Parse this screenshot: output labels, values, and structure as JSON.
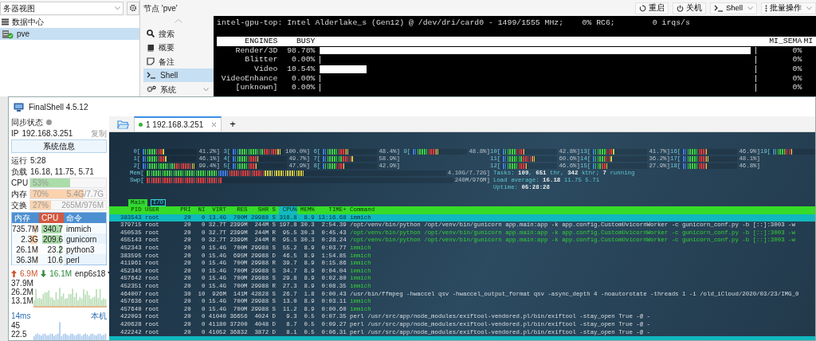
{
  "proxmox": {
    "tree": {
      "view_select": "务器视图",
      "items": [
        {
          "label": "数据中心",
          "kind": "datacenter",
          "selected": false
        },
        {
          "label": "pve",
          "kind": "node",
          "selected": true
        }
      ]
    },
    "header": {
      "title": "节点 'pve'",
      "buttons": [
        {
          "label": "重启",
          "kind": "restart",
          "dropdown": false
        },
        {
          "label": "关机",
          "kind": "power",
          "dropdown": false
        },
        {
          "label": "Shell",
          "kind": "shell",
          "dropdown": true
        },
        {
          "label": "批量操作",
          "kind": "bulk",
          "dropdown": true
        }
      ]
    },
    "nav": [
      {
        "label": "搜索",
        "kind": "search",
        "selected": false,
        "expandable": false
      },
      {
        "label": "概要",
        "kind": "summary",
        "selected": false,
        "expandable": false
      },
      {
        "label": "备注",
        "kind": "notes",
        "selected": false,
        "expandable": false
      },
      {
        "label": "Shell",
        "kind": "shell",
        "selected": true,
        "expandable": false
      },
      {
        "label": "系统",
        "kind": "system",
        "selected": false,
        "expandable": true
      }
    ],
    "gpu_top": {
      "title_line": "intel-gpu-top: Intel Alderlake_s (Gen12) @ /dev/dri/card0 - 1499/1555 MHz;    0% RC6;        0 irqs/s",
      "columns": [
        "ENGINES",
        "BUSY",
        "MI_SEMA",
        "MI"
      ],
      "rows": [
        {
          "engine": "Render/3D",
          "busy": "98.78%",
          "level": 0.9878,
          "sema": "0%"
        },
        {
          "engine": "Blitter",
          "busy": "0.00%",
          "level": 0,
          "sema": "0%"
        },
        {
          "engine": "Video",
          "busy": "10.54%",
          "level": 0.1054,
          "sema": "0%"
        },
        {
          "engine": "VideoEnhance",
          "busy": "0.00%",
          "level": 0,
          "sema": "0%"
        },
        {
          "engine": "[unknown]",
          "busy": "0.00%",
          "level": 0,
          "sema": "0%"
        }
      ]
    }
  },
  "finalshell": {
    "title": "FinalShell 4.5.12",
    "sidebar": {
      "sync_label": "同步状态",
      "sync_on": false,
      "ip_label": "IP",
      "ip": "192.168.3.251",
      "copy": "复制",
      "sysinfo_button": "系统信息",
      "uptime_label": "运行",
      "uptime": "5:28",
      "load_label": "负载",
      "load": "16.18, 11.75, 5.71",
      "meters": [
        {
          "label": "CPU",
          "percent": "53%",
          "level": 0.53,
          "kind": "cpu"
        },
        {
          "label": "内存",
          "percent": "70%",
          "detail": "5.4G/7.7G",
          "level": 0.7,
          "kind": "memory"
        },
        {
          "label": "交换",
          "percent": "27%",
          "detail": "265M/976M",
          "level": 0.27,
          "kind": "swap"
        }
      ],
      "process_columns": [
        {
          "label": "内存",
          "sorted": false
        },
        {
          "label": "CPU",
          "sorted": true
        },
        {
          "label": "命令",
          "sorted": false
        }
      ],
      "processes": [
        {
          "mem": {
            "text": "735.7M",
            "level": 0.1
          },
          "cpu": {
            "text": "340.7",
            "level": 1
          },
          "command": "immich"
        },
        {
          "mem": {
            "text": "2.3G",
            "level": 0.3
          },
          "cpu": {
            "text": "209.6",
            "level": 0.95
          },
          "command": "gunicorn"
        },
        {
          "mem": {
            "text": "26.1M",
            "level": 0.03
          },
          "cpu": {
            "text": "23.2",
            "level": 0.12
          },
          "command": "python3"
        },
        {
          "mem": {
            "text": "36.3M",
            "level": 0.03
          },
          "cpu": {
            "text": "10.6",
            "level": 0.06
          },
          "command": "perl"
        }
      ],
      "network": {
        "upload": "6.9M",
        "download": "16.1M",
        "interface": "enp6s18",
        "scale": [
          "37.9M",
          "26.2M",
          "13.1M"
        ]
      },
      "ping": {
        "latency": "14ms",
        "target": "本机",
        "scale": [
          "45",
          "22.5"
        ]
      }
    },
    "tabs": [
      {
        "label": "1 192.168.3.251",
        "selected": true,
        "connected": true
      }
    ],
    "new_tab": "+",
    "htop": {
      "cpu_columns": [
        [
          {
            "label": "0[",
            "reading": "41.2%]",
            "level": 0.412
          },
          {
            "label": "1[",
            "reading": "46.1%]",
            "level": 0.461
          },
          {
            "label": "2[",
            "reading": "99.4%]",
            "level": 0.994
          }
        ],
        [
          {
            "label": "3[",
            "reading": "100.0%]",
            "level": 1
          },
          {
            "label": "4[",
            "reading": "49.7%]",
            "level": 0.497
          },
          {
            "label": "5[",
            "reading": "47.9%]",
            "level": 0.479
          }
        ],
        [
          {
            "label": "6[",
            "reading": "48.4%]",
            "level": 0.484
          },
          {
            "label": "7[",
            "reading": "58.9%]",
            "level": 0.589
          },
          {
            "label": "8[",
            "reading": "42.9%]",
            "level": 0.429
          }
        ],
        [
          {
            "label": "9[",
            "reading": "48.8%]",
            "level": 0.488
          }
        ],
        [
          {
            "label": "10[",
            "reading": "42.8%]",
            "level": 0.428
          },
          {
            "label": "11[",
            "reading": "60.6%]",
            "level": 0.606
          },
          {
            "label": "12[",
            "reading": "46.6%]",
            "level": 0.466
          }
        ],
        [
          {
            "label": "13[",
            "reading": "41.7%]",
            "level": 0.417
          },
          {
            "label": "14[",
            "reading": "36.2%]",
            "level": 0.362
          },
          {
            "label": "15[",
            "reading": "27.9%]",
            "level": 0.279
          }
        ],
        [
          {
            "label": "16[",
            "reading": "46.9%]",
            "level": 0.469
          },
          {
            "label": "17[",
            "reading": "48.1%]",
            "level": 0.481
          },
          {
            "label": "18[",
            "reading": "46.8%]",
            "level": 0.468
          }
        ],
        [
          {
            "label": "19[",
            "level": 0.5
          }
        ]
      ],
      "memory_meters": [
        {
          "label": "Mem[",
          "reading": "4.10G/7.72G]",
          "level": 0.53,
          "kind": "mem"
        },
        {
          "label": "Swp[",
          "reading": "240M/976M]",
          "level": 0.25,
          "kind": "swap"
        }
      ],
      "summary": [
        "Tasks: **109**, **651** thr, **342** kthr; **7** running",
        "Load average: **16.18** 11.75 5.71",
        "Uptime: **05:28:28**"
      ],
      "tabs": [
        {
          "label": "Main",
          "selected": true
        },
        {
          "label": "I/O",
          "selected": false
        }
      ],
      "columns": [
        {
          "label": "PID",
          "sorted": false
        },
        {
          "label": "USER",
          "sorted": false
        },
        {
          "label": "PRI",
          "sorted": false
        },
        {
          "label": "NI",
          "sorted": false
        },
        {
          "label": "VIRT",
          "sorted": false
        },
        {
          "label": "RES",
          "sorted": false
        },
        {
          "label": "SHR",
          "sorted": false
        },
        {
          "label": "S",
          "sorted": false
        },
        {
          "label": "CPU%",
          "sorted": true
        },
        {
          "label": "MEM%",
          "sorted": false
        },
        {
          "label": "TIME+",
          "sorted": false
        },
        {
          "label": "Command",
          "sorted": false
        }
      ],
      "rows": [
        {
          "pid": "383543",
          "user": "root",
          "pri": "20",
          "ni": "0",
          "virt": "13.4G",
          "res": "700M",
          "shr": "29988",
          "state": "S",
          "cpu": "318.8",
          "mem": "8.9",
          "time": "13:16.68",
          "command": "immich",
          "selected": true,
          "thread": false
        },
        {
          "pid": "379715",
          "user": "root",
          "pri": "20",
          "ni": "0",
          "virt": "32.7T",
          "res": "2399M",
          "shr": "244M",
          "state": "S",
          "cpu": "197.8",
          "mem": "30.3",
          "time": "2:54.39",
          "command": "/opt/venv/bin/python /opt/venv/bin/gunicorn app.main:app -k app.config.CustomUvicornWorker -c gunicorn_conf.py -b [::]:3003 -w",
          "selected": false,
          "thread": false
        },
        {
          "pid": "450535",
          "user": "root",
          "pri": "20",
          "ni": "0",
          "virt": "32.7T",
          "res": "2399M",
          "shr": "244M",
          "state": "R",
          "cpu": "95.5",
          "mem": "30.3",
          "time": "0:45.43",
          "command": "/opt/venv/bin/python /opt/venv/bin/gunicorn app.main:app -k app.config.CustomUvicornWorker -c gunicorn_conf.py -b [::]:3003 -w",
          "selected": false,
          "thread": true
        },
        {
          "pid": "455143",
          "user": "root",
          "pri": "20",
          "ni": "0",
          "virt": "32.7T",
          "res": "2399M",
          "shr": "244M",
          "state": "R",
          "cpu": "95.5",
          "mem": "30.3",
          "time": "0:28.24",
          "command": "/opt/venv/bin/python /opt/venv/bin/gunicorn app.main:app -k app.config.CustomUvicornWorker -c gunicorn_conf.py -b [::]:3003 -w",
          "selected": false,
          "thread": true
        },
        {
          "pid": "452343",
          "user": "root",
          "pri": "20",
          "ni": "0",
          "virt": "15.4G",
          "res": "700M",
          "shr": "29988",
          "state": "S",
          "cpu": "55.2",
          "mem": "8.9",
          "time": "0:03.77",
          "command": "immich",
          "selected": false,
          "thread": true
        },
        {
          "pid": "383595",
          "user": "root",
          "pri": "20",
          "ni": "0",
          "virt": "15.4G",
          "res": "695M",
          "shr": "29988",
          "state": "D",
          "cpu": "46.5",
          "mem": "8.9",
          "time": "1:54.85",
          "command": "immich",
          "selected": false,
          "thread": true
        },
        {
          "pid": "411961",
          "user": "root",
          "pri": "20",
          "ni": "0",
          "virt": "15.4G",
          "res": "700M",
          "shr": "29988",
          "state": "R",
          "cpu": "39.7",
          "mem": "8.9",
          "time": "0:15.86",
          "command": "immich",
          "selected": false,
          "thread": true
        },
        {
          "pid": "452345",
          "user": "root",
          "pri": "20",
          "ni": "0",
          "virt": "15.4G",
          "res": "700M",
          "shr": "29988",
          "state": "S",
          "cpu": "34.7",
          "mem": "8.9",
          "time": "0:04.04",
          "command": "immich",
          "selected": false,
          "thread": true
        },
        {
          "pid": "457642",
          "user": "root",
          "pri": "20",
          "ni": "0",
          "virt": "15.4G",
          "res": "700M",
          "shr": "29988",
          "state": "S",
          "cpu": "29.8",
          "mem": "8.9",
          "time": "0:02.80",
          "command": "immich",
          "selected": false,
          "thread": true
        },
        {
          "pid": "452351",
          "user": "root",
          "pri": "20",
          "ni": "0",
          "virt": "15.4G",
          "res": "700M",
          "shr": "29988",
          "state": "R",
          "cpu": "27.3",
          "mem": "8.9",
          "time": "0:08.35",
          "command": "immich",
          "selected": false,
          "thread": true
        },
        {
          "pid": "464007",
          "user": "root",
          "pri": "30",
          "ni": "10",
          "virt": "926M",
          "res": "141M",
          "shr": "42828",
          "state": "S",
          "cpu": "26.7",
          "mem": "1.8",
          "time": "0:00.43",
          "command": "/usr/bin/ffmpeg -hwaccel qsv -hwaccel_output_format qsv -async_depth 4 -noautorotate -threads 1 -i /old_iCloud/2020/03/23/IMG_0",
          "selected": false,
          "thread": false
        },
        {
          "pid": "457636",
          "user": "root",
          "pri": "20",
          "ni": "0",
          "virt": "15.4G",
          "res": "700M",
          "shr": "29988",
          "state": "S",
          "cpu": "13.0",
          "mem": "8.9",
          "time": "0:03.11",
          "command": "immich",
          "selected": false,
          "thread": true
        },
        {
          "pid": "457640",
          "user": "root",
          "pri": "20",
          "ni": "0",
          "virt": "15.4G",
          "res": "700M",
          "shr": "29988",
          "state": "S",
          "cpu": "11.2",
          "mem": "8.9",
          "time": "0:00.60",
          "command": "immich",
          "selected": false,
          "thread": true
        },
        {
          "pid": "422093",
          "user": "root",
          "pri": "20",
          "ni": "0",
          "virt": "41040",
          "res": "36656",
          "shr": "4024",
          "state": "D",
          "cpu": "9.3",
          "mem": "0.5",
          "time": "0:07.35",
          "command": "perl /usr/src/app/node_modules/exiftool-vendored.pl/bin/exiftool -stay_open True -@ -",
          "selected": false,
          "thread": false
        },
        {
          "pid": "420628",
          "user": "root",
          "pri": "20",
          "ni": "0",
          "virt": "41180",
          "res": "37200",
          "shr": "4048",
          "state": "D",
          "cpu": "8.7",
          "mem": "0.5",
          "time": "0:09.27",
          "command": "perl /usr/src/app/node_modules/exiftool-vendored.pl/bin/exiftool -stay_open True -@ -",
          "selected": false,
          "thread": false
        },
        {
          "pid": "422242",
          "user": "root",
          "pri": "20",
          "ni": "0",
          "virt": "41052",
          "res": "36832",
          "shr": "3872",
          "state": "D",
          "cpu": "8.1",
          "mem": "0.5",
          "time": "0:06.31",
          "command": "perl /usr/src/app/node_modules/exiftool-vendored.pl/bin/exiftool -stay_open True -@ -",
          "selected": false,
          "thread": false
        }
      ]
    }
  }
}
